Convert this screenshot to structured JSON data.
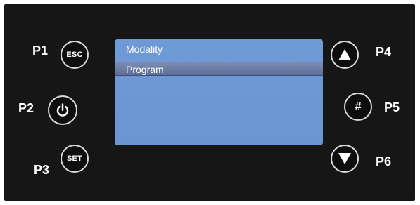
{
  "labels": {
    "p1": "P1",
    "p2": "P2",
    "p3": "P3",
    "p4": "P4",
    "p5": "P5",
    "p6": "P6"
  },
  "buttons": {
    "esc": "ESC",
    "set": "SET",
    "hash": "#"
  },
  "screen": {
    "rows": [
      "Modality",
      "Program"
    ],
    "selected_index": 1
  },
  "icons": {
    "power": "power-icon",
    "up": "up-arrow-icon",
    "down": "down-arrow-icon"
  },
  "colors": {
    "panel": "#161616",
    "screen": "#6f9ad6",
    "highlight": "#6d7fa8"
  }
}
